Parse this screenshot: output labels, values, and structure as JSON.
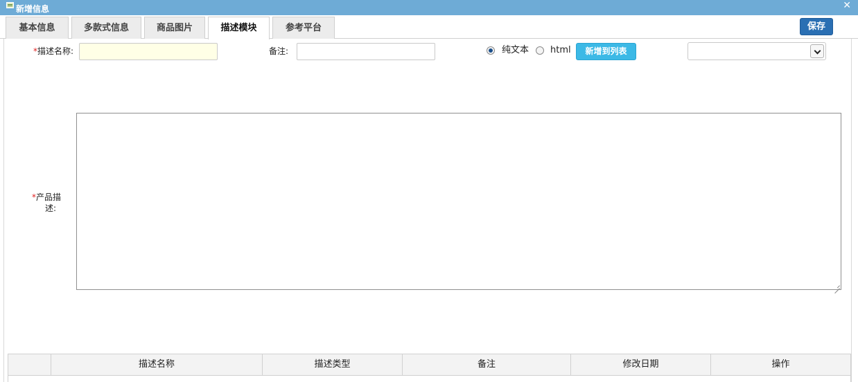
{
  "window": {
    "title": "新增信息"
  },
  "tabs": [
    {
      "label": "基本信息"
    },
    {
      "label": "多款式信息"
    },
    {
      "label": "商品图片"
    },
    {
      "label": "描述模块"
    },
    {
      "label": "参考平台"
    }
  ],
  "active_tab": "描述模块",
  "toolbar": {
    "save_label": "保存"
  },
  "form": {
    "required_mark": "*",
    "desc_name_label": "描述名称:",
    "desc_name_value": "",
    "remark_label": "备注:",
    "remark_value": "",
    "type_options": [
      {
        "label": "纯文本",
        "checked": true
      },
      {
        "label": "html",
        "checked": false
      }
    ],
    "add_to_list_label": "新增到列表",
    "select_value": "",
    "product_desc_label_1": "产品描",
    "product_desc_label_2": "述:",
    "product_desc_value": ""
  },
  "table": {
    "columns": [
      "",
      "描述名称",
      "描述类型",
      "备注",
      "修改日期",
      "操作"
    ]
  },
  "icons": [
    "window-icon",
    "close-icon",
    "chevron-down-icon",
    "resize-grip-icon"
  ]
}
